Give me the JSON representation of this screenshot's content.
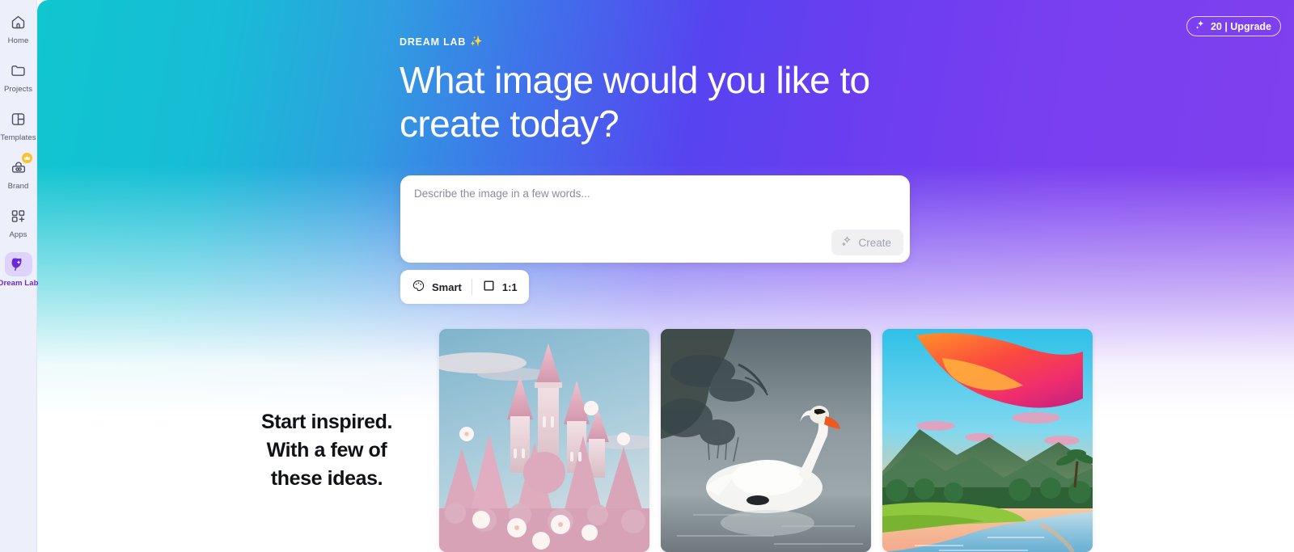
{
  "sidebar": {
    "items": [
      {
        "label": "Home",
        "icon": "home-icon",
        "active": false,
        "badge": null
      },
      {
        "label": "Projects",
        "icon": "folder-icon",
        "active": false,
        "badge": null
      },
      {
        "label": "Templates",
        "icon": "templates-icon",
        "active": false,
        "badge": null
      },
      {
        "label": "Brand",
        "icon": "brand-kit-icon",
        "active": false,
        "badge": "crown-icon"
      },
      {
        "label": "Apps",
        "icon": "apps-grid-plus-icon",
        "active": false,
        "badge": null
      },
      {
        "label": "Dream Lab",
        "icon": "dream-lab-icon",
        "active": true,
        "badge": null
      }
    ]
  },
  "header": {
    "upgrade_badge": {
      "icon": "sparkle-icon",
      "label": "20 | Upgrade",
      "credits": "20"
    }
  },
  "hero": {
    "eyebrow": "DREAM LAB",
    "eyebrow_icon": "✨",
    "title": "What image would you like to create today?"
  },
  "prompt": {
    "placeholder": "Describe the image in a few words...",
    "value": "",
    "create_button": {
      "label": "Create",
      "icon": "sparkle-icon",
      "disabled": true
    }
  },
  "options": {
    "style": {
      "label": "Smart",
      "icon": "palette-icon"
    },
    "aspect_ratio": {
      "label": "1:1",
      "icon": "square-icon"
    }
  },
  "inspire": {
    "heading": "Start inspired. With a few of these ideas.",
    "thumbnails": [
      {
        "name": "pink-fantasy-castle",
        "alt": "Pink floral fantasy castle with spires under a blue sky"
      },
      {
        "name": "misty-swan",
        "alt": "White swan gliding on misty dark water by a treeline"
      },
      {
        "name": "tropical-sunset-river",
        "alt": "Vivid orange and pink sunset over green mountains and a river"
      }
    ]
  },
  "colors": {
    "gradient_start": "#10c6cf",
    "gradient_mid": "#3f73ea",
    "gradient_end": "#8140ee",
    "sidebar_bg": "#edf0fa",
    "accent_purple": "#6b28d9",
    "active_pill": "#ded4fb",
    "crown_badge": "#fbc02d",
    "card_bg": "#ffffff",
    "create_disabled_bg": "#f0f0f3"
  }
}
